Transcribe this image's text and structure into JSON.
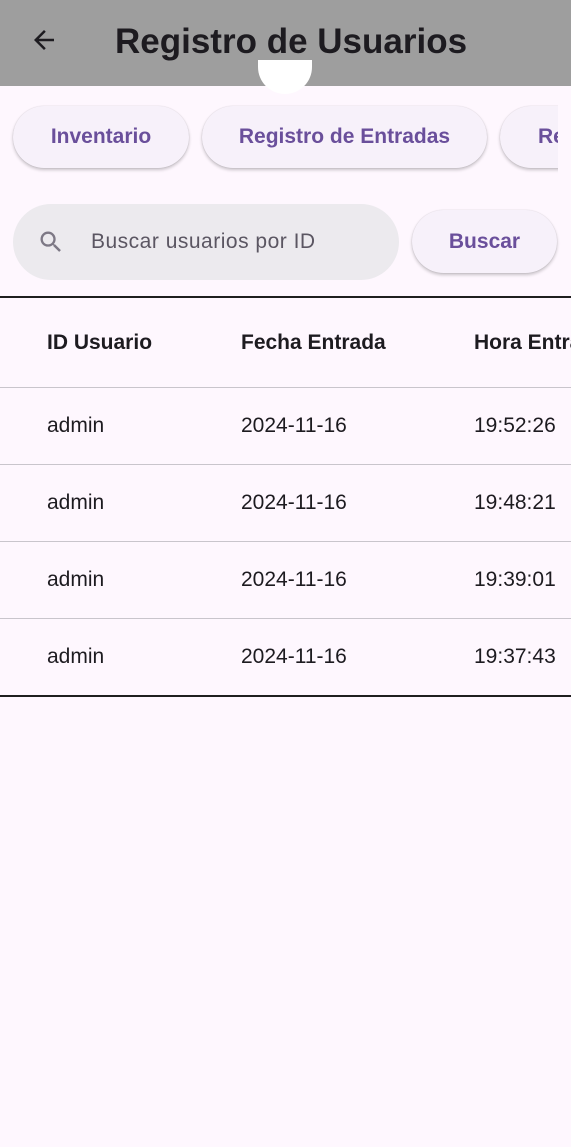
{
  "app_bar": {
    "title": "Registro de Usuarios",
    "back_icon": "arrow-back-icon"
  },
  "chips": [
    {
      "label": "Inventario"
    },
    {
      "label": "Registro de Entradas"
    },
    {
      "label": "Re"
    }
  ],
  "search": {
    "placeholder": "Buscar usuarios por ID",
    "value": "",
    "icon": "search-icon",
    "button_label": "Buscar"
  },
  "table": {
    "headers": [
      "ID Usuario",
      "Fecha Entrada",
      "Hora Entra"
    ],
    "rows": [
      [
        "admin",
        "2024-11-16",
        "19:52:26"
      ],
      [
        "admin",
        "2024-11-16",
        "19:48:21"
      ],
      [
        "admin",
        "2024-11-16",
        "19:39:01"
      ],
      [
        "admin",
        "2024-11-16",
        "19:37:43"
      ]
    ]
  },
  "colors": {
    "app_bar_bg": "#9e9e9e",
    "page_bg": "#fef7fe",
    "accent": "#6a4f9b"
  }
}
